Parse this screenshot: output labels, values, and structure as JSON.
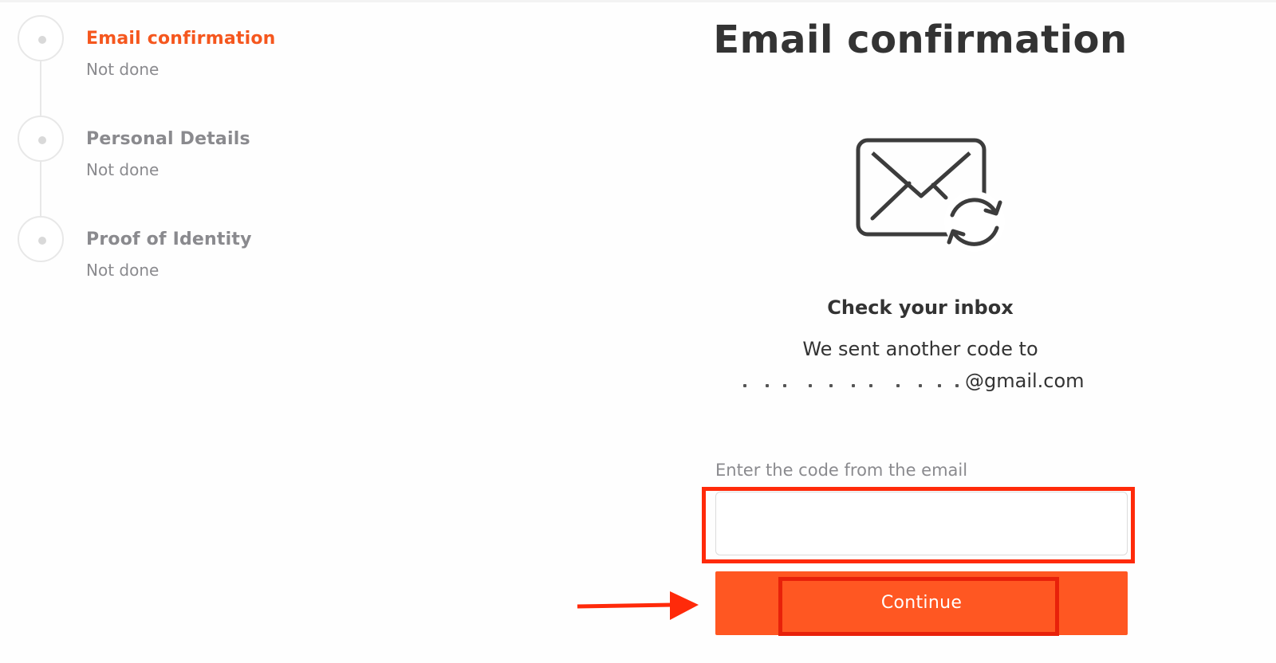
{
  "stepper": {
    "steps": [
      {
        "title": "Email confirmation",
        "status": "Not done",
        "active": true
      },
      {
        "title": "Personal Details",
        "status": "Not done",
        "active": false
      },
      {
        "title": "Proof of Identity",
        "status": "Not done",
        "active": false
      }
    ]
  },
  "main": {
    "title": "Email confirmation",
    "icon": "mail-refresh-icon",
    "heading": "Check your inbox",
    "sent_text": "We sent another code to",
    "email_visible": "@gmail.com",
    "code_label": "Enter the code from the email",
    "code_value": "",
    "continue_label": "Continue"
  },
  "colors": {
    "accent": "#ff5722",
    "active_step": "#f5571e",
    "annotation_red": "#ff2a0a",
    "text_dark": "#333333",
    "text_muted": "#8a8a8e"
  }
}
